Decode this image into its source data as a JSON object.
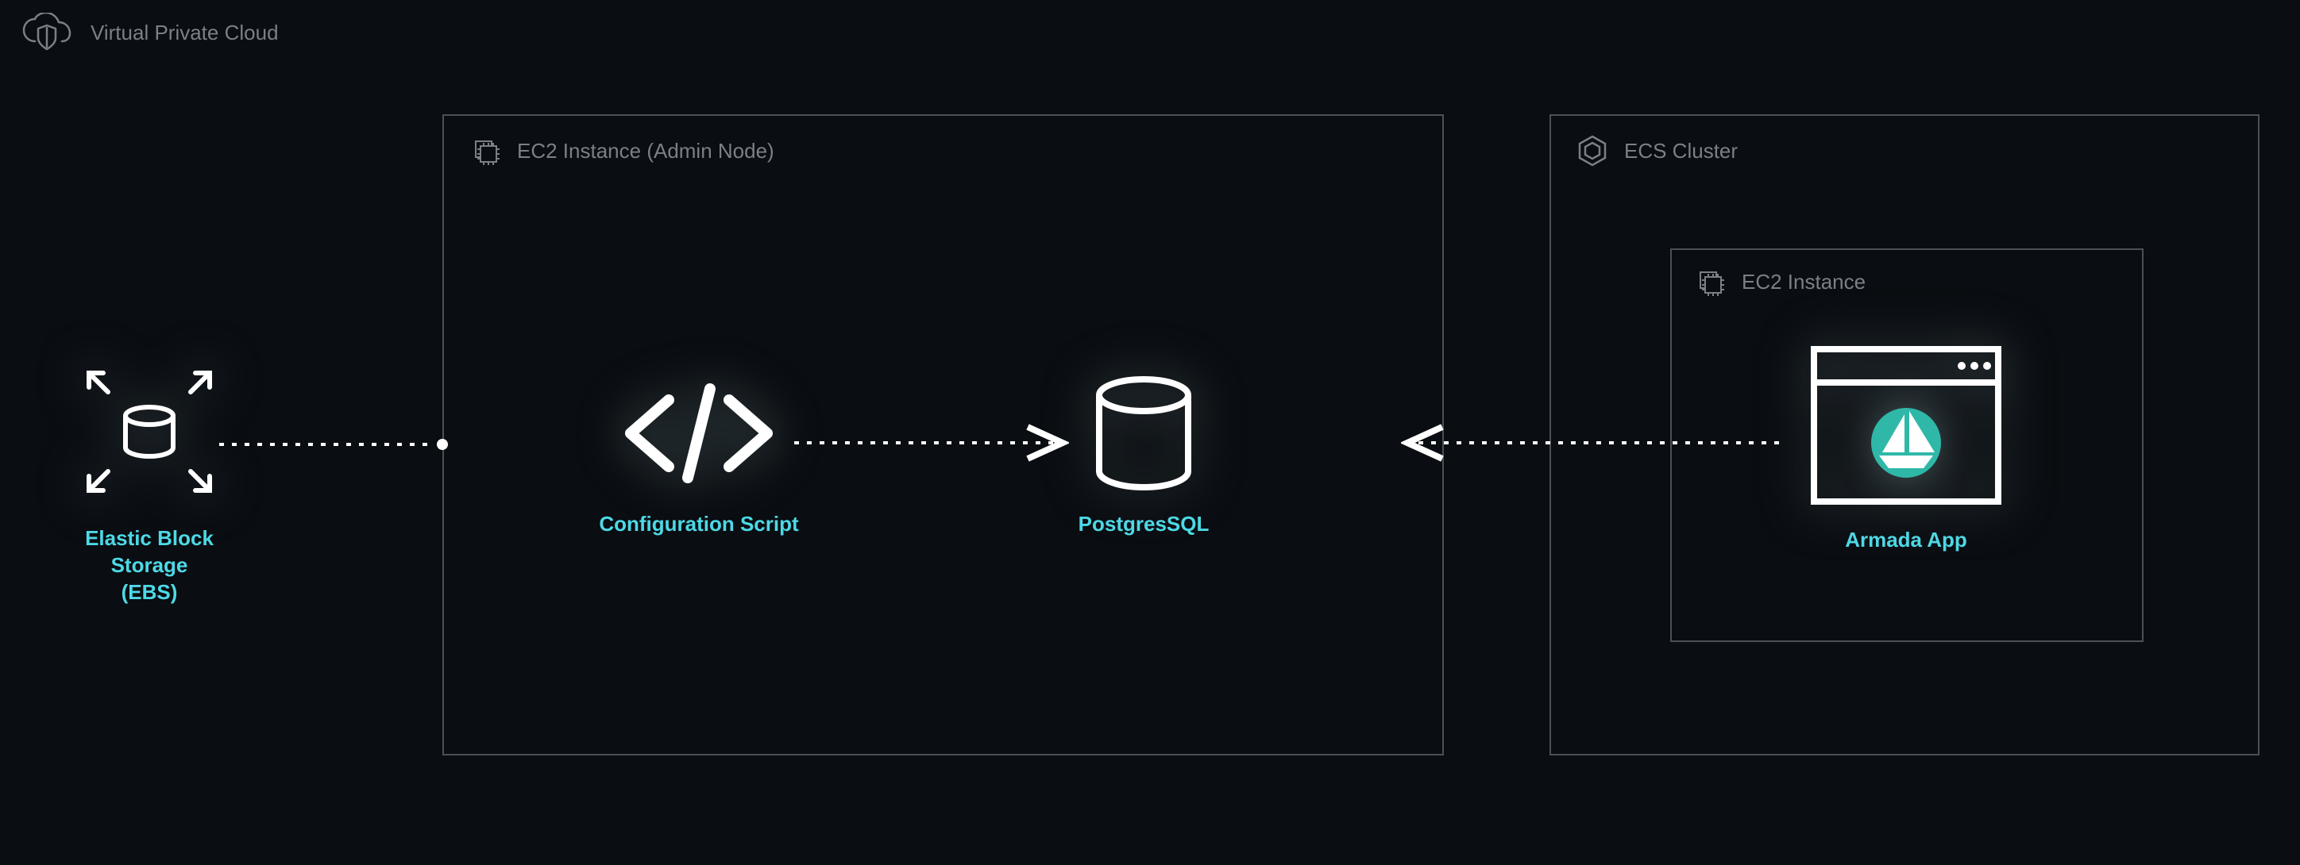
{
  "vpc": {
    "label": "Virtual Private Cloud"
  },
  "containers": {
    "ec2_admin": {
      "label": "EC2 Instance (Admin Node)"
    },
    "ecs_cluster": {
      "label": "ECS Cluster"
    },
    "ec2_instance": {
      "label": "EC2 Instance"
    }
  },
  "nodes": {
    "ebs": {
      "label_line1": "Elastic Block Storage",
      "label_line2": "(EBS)"
    },
    "config_script": {
      "label": "Configuration Script"
    },
    "postgres": {
      "label": "PostgresSQL"
    },
    "armada": {
      "label": "Armada App"
    }
  },
  "colors": {
    "accent": "#4dd9e6",
    "border": "#4a5058",
    "muted": "#7a8088",
    "bg": "#0a0d11",
    "white": "#ffffff"
  }
}
